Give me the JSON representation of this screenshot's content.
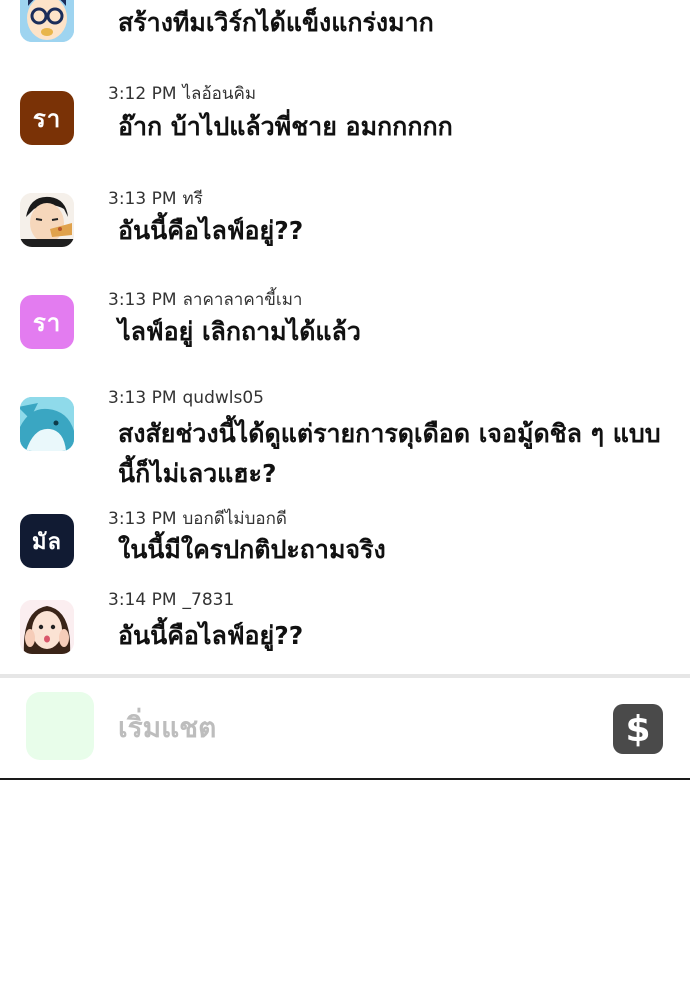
{
  "messages": [
    {
      "time": "",
      "user": "",
      "text": "สร้างทีมเวิร์กได้แข็งแกร่งมาก",
      "avatar": {
        "type": "icon",
        "icon": "glasses-face-icon"
      }
    },
    {
      "time": "3:12 PM",
      "user": "ไลอ้อนคิม",
      "text": "อ๊าก บ้าไปแล้วพี่ชาย อมกกกกก",
      "avatar": {
        "type": "initials",
        "initials": "รา",
        "color": "#7a3206"
      }
    },
    {
      "time": "3:13 PM",
      "user": "ทรี",
      "text": "อันนี้คือไลฟ์อยู่??",
      "avatar": {
        "type": "icon",
        "icon": "eating-man-icon"
      }
    },
    {
      "time": "3:13 PM",
      "user": "ลาคาลาคาขี้เมา",
      "text": "ไลฟ์อยู่ เลิกถามได้แล้ว",
      "avatar": {
        "type": "initials",
        "initials": "รา",
        "color": "#e37cf0"
      }
    },
    {
      "time": "3:13 PM",
      "user": "qudwls05",
      "text": "สงสัยช่วงนี้ได้ดูแต่รายการดุเดือด เจอมู้ดชิล ๆ แบบนี้ก็ไม่เลวแฮะ?",
      "avatar": {
        "type": "icon",
        "icon": "whale-icon"
      }
    },
    {
      "time": "3:13 PM",
      "user": "บอกดีไม่บอกดี",
      "text": "ในนี้มีใครปกติปะถามจริง",
      "avatar": {
        "type": "initials",
        "initials": "มัล",
        "color": "#111b33"
      }
    },
    {
      "time": "3:14 PM",
      "user": "_7831",
      "text": "อันนี้คือไลฟ์อยู่??",
      "avatar": {
        "type": "icon",
        "icon": "surprised-girl-icon"
      }
    }
  ],
  "composer": {
    "placeholder": "เริ่มแชต",
    "donate_icon": "dollar-icon",
    "donate_symbol": "$",
    "accent_color": "#e8fdea"
  }
}
